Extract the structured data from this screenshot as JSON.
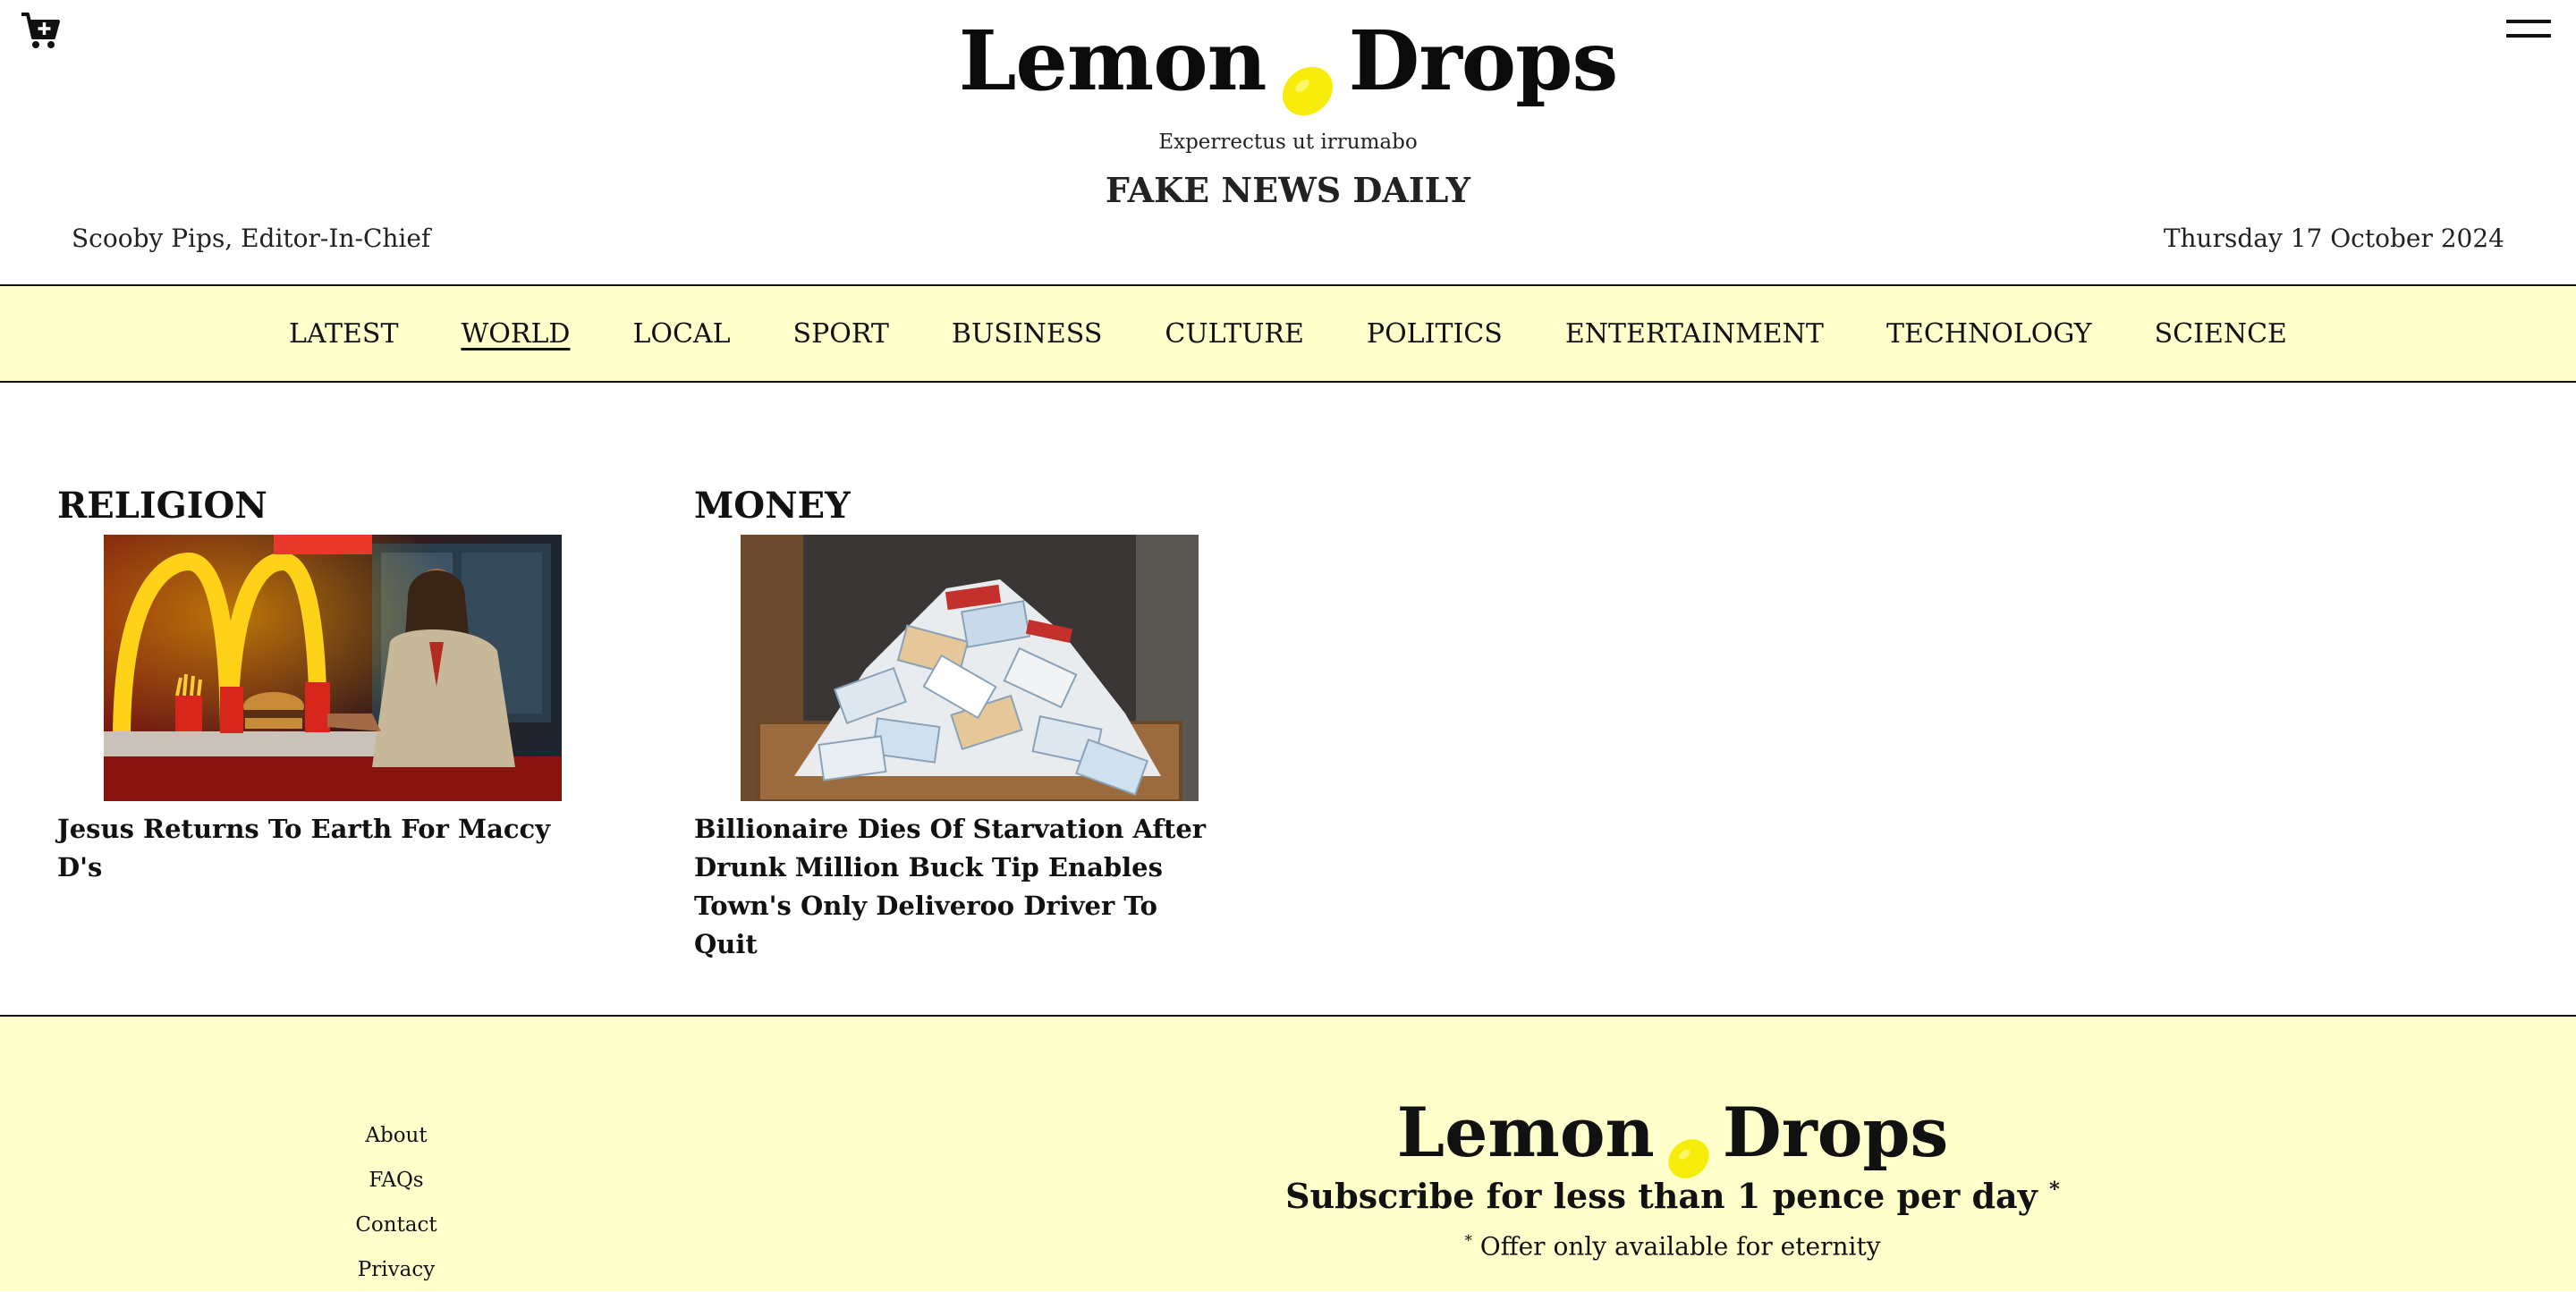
{
  "header": {
    "logo_left": "Lemon",
    "logo_right": "Drops",
    "tagline": "Experrectus ut irrumabo",
    "paper_name": "FAKE NEWS DAILY",
    "editor": "Scooby Pips, Editor-In-Chief",
    "date": "Thursday 17 October 2024",
    "icons": {
      "cart": "cart-add-icon",
      "menu": "hamburger-menu-icon",
      "logo": "lemon-icon"
    }
  },
  "nav": {
    "items": [
      {
        "label": "LATEST",
        "active": false
      },
      {
        "label": "WORLD",
        "active": true
      },
      {
        "label": "LOCAL",
        "active": false
      },
      {
        "label": "SPORT",
        "active": false
      },
      {
        "label": "BUSINESS",
        "active": false
      },
      {
        "label": "CULTURE",
        "active": false
      },
      {
        "label": "POLITICS",
        "active": false
      },
      {
        "label": "ENTERTAINMENT",
        "active": false
      },
      {
        "label": "TECHNOLOGY",
        "active": false
      },
      {
        "label": "SCIENCE",
        "active": false
      }
    ]
  },
  "sections": [
    {
      "title": "RELIGION",
      "headline": "Jesus Returns To Earth For Maccy D's"
    },
    {
      "title": "MONEY",
      "headline": "Billionaire Dies Of Starvation After Drunk Million Buck Tip Enables Town's Only Deliveroo Driver To Quit"
    }
  ],
  "footer": {
    "links": [
      "About",
      "FAQs",
      "Contact",
      "Privacy"
    ],
    "logo_left": "Lemon",
    "logo_right": "Drops",
    "subscribe_text": "Subscribe for less than 1 pence per day",
    "subscribe_mark": "*",
    "offer_mark": "*",
    "offer_text": "Offer only available for eternity"
  },
  "colors": {
    "accent_background": "#ffffcc",
    "lemon": "#f6ee0a",
    "text": "#111111"
  }
}
